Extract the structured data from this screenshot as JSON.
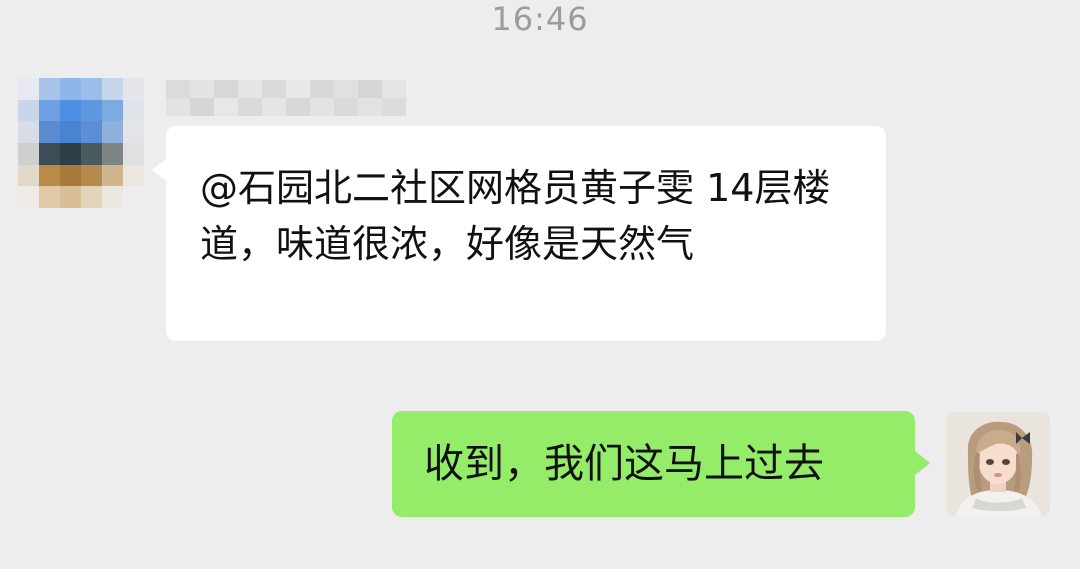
{
  "chat": {
    "timestamp": "16:46",
    "messages": [
      {
        "direction": "incoming",
        "sender_name_obscured": true,
        "text": "@石园北二社区网格员黄子雯 14层楼道，味道很浓，好像是天然气"
      },
      {
        "direction": "outgoing",
        "text": "收到，我们这马上过去"
      }
    ]
  },
  "colors": {
    "background": "#ededed",
    "incoming_bubble": "#ffffff",
    "outgoing_bubble": "#95ec69",
    "timestamp_text": "#9b9b9b"
  },
  "icons": {
    "sender_avatar": "pixelated-avatar",
    "self_avatar": "illustrated-girl-avatar"
  }
}
